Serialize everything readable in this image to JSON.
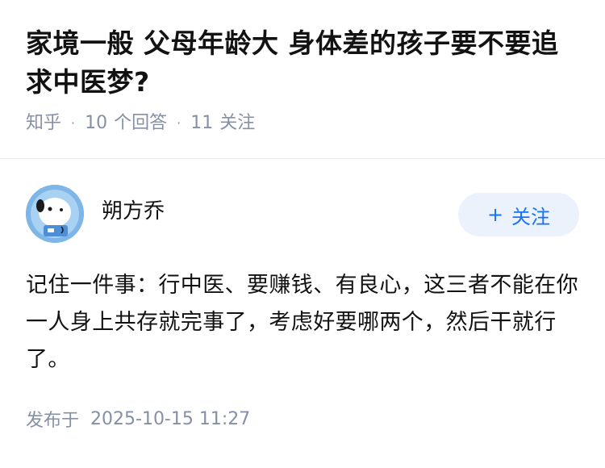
{
  "question": {
    "title": "家境一般 父母年龄大 身体差的孩子要不要追求中医梦?",
    "source": "知乎",
    "answers_count": "10",
    "answers_label": "个回答",
    "followers_count": "11",
    "followers_label": "关注"
  },
  "answer": {
    "author_name": "朔方乔",
    "follow_plus": "+",
    "follow_label": "关注",
    "content": "记住一件事：行中医、要赚钱、有良心，这三者不能在你一人身上共存就完事了，考虑好要哪两个，然后干就行了。",
    "published_label": "发布于",
    "published_date": "2025-10-15 11:27"
  },
  "icons": {
    "avatar": "robot-dog-avatar-icon"
  },
  "colors": {
    "accent": "#1772f6",
    "follow_bg": "#ebf2fc",
    "meta": "#8590a6"
  }
}
